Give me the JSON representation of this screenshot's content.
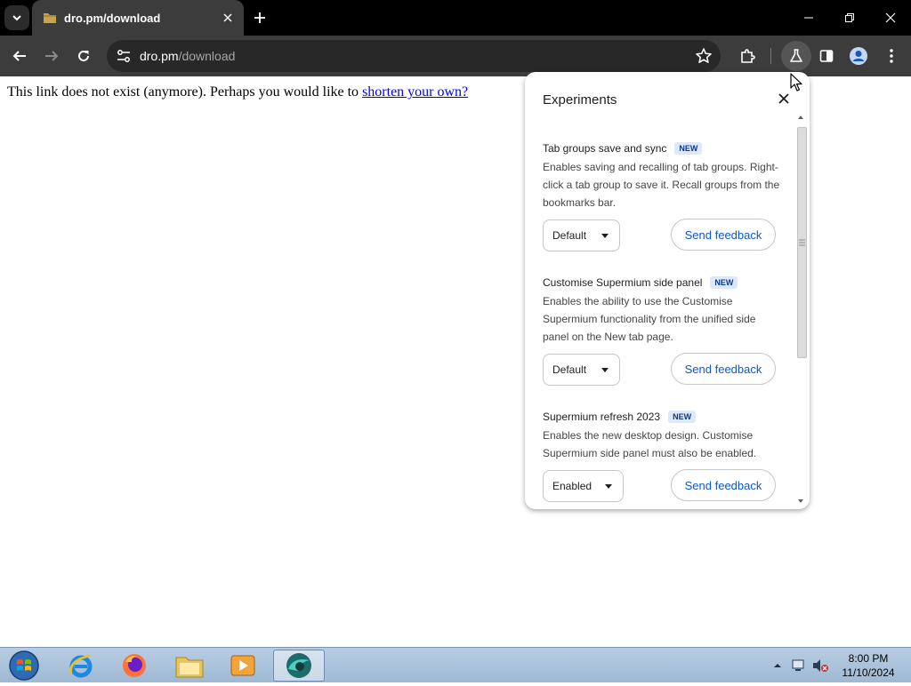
{
  "browser": {
    "tab_title": "dro.pm/download",
    "url_host": "dro.pm",
    "url_path": "/download"
  },
  "page": {
    "message": "This link does not exist (anymore). Perhaps you would like to ",
    "link_text": "shorten your own?"
  },
  "experiments": {
    "title": "Experiments",
    "new_badge": "NEW",
    "items": [
      {
        "title": "Tab groups save and sync",
        "description": "Enables saving and recalling of tab groups. Right-click a tab group to save it. Recall groups from the bookmarks bar.",
        "selected": "Default",
        "feedback_label": "Send feedback"
      },
      {
        "title": "Customise Supermium side panel",
        "description": "Enables the ability to use the Customise Supermium functionality from the unified side panel on the New tab page.",
        "selected": "Default",
        "feedback_label": "Send feedback"
      },
      {
        "title": "Supermium refresh 2023",
        "description": "Enables the new desktop design. Customise Supermium side panel must also be enabled.",
        "selected": "Enabled",
        "feedback_label": "Send feedback"
      }
    ]
  },
  "taskbar": {
    "apps": [
      "start-orb",
      "internet-explorer",
      "firefox",
      "file-explorer",
      "media-player",
      "supermium-browser"
    ],
    "time": "8:00 PM",
    "date": "11/10/2024"
  },
  "colors": {
    "accent_blue": "#0b57d0",
    "chrome_dark": "#3c3c3c",
    "link": "#0000ee"
  }
}
